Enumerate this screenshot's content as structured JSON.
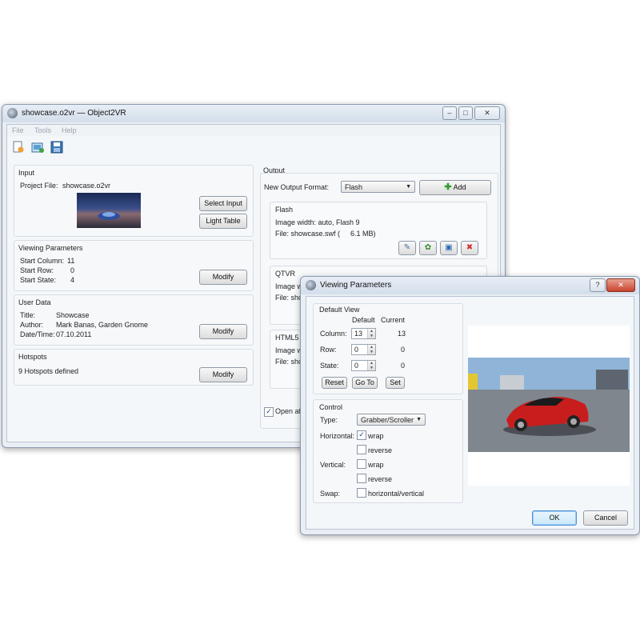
{
  "main": {
    "title": "showcase.o2vr — Object2VR",
    "menu": [
      "File",
      "Tools",
      "Help"
    ],
    "toolbar_icons": [
      "new-project-icon",
      "open-project-icon",
      "save-project-icon"
    ],
    "input": {
      "title": "Input",
      "project_file_label": "Project File:",
      "project_file": "showcase.o2vr",
      "select_input": "Select Input",
      "light_table": "Light Table"
    },
    "viewing": {
      "title": "Viewing Parameters",
      "start_column_label": "Start Column:",
      "start_column": "11",
      "start_row_label": "Start Row:",
      "start_row": "0",
      "start_state_label": "Start State:",
      "start_state": "4",
      "modify": "Modify"
    },
    "user_data": {
      "title": "User Data",
      "title_label": "Title:",
      "title_value": "Showcase",
      "author_label": "Author:",
      "author_value": "Mark Banas, Garden Gnome",
      "date_label": "Date/Time:",
      "date_value": "07.10.2011",
      "modify": "Modify"
    },
    "hotspots": {
      "title": "Hotspots",
      "text": "9 Hotspots defined",
      "modify": "Modify"
    },
    "output": {
      "title": "Output",
      "new_format_label": "New Output Format:",
      "format": "Flash",
      "add": "Add",
      "flash": {
        "title": "Flash",
        "line1": "Image width: auto, Flash 9",
        "line2": "File: showcase.swf (",
        "size": "6.1 MB)"
      },
      "qtvr": {
        "title": "QTVR",
        "line1": "Image w",
        "line2": "File: sho"
      },
      "html5": {
        "title": "HTML5",
        "line1": "Image wi",
        "line2": "File: sho"
      },
      "open_after": "Open aft"
    }
  },
  "dialog": {
    "title": "Viewing Parameters",
    "help": "?",
    "close": "✕",
    "default_view": {
      "title": "Default View",
      "col_default": "Default",
      "col_current": "Current",
      "rows": [
        {
          "label": "Column:",
          "default": "13",
          "current": "13"
        },
        {
          "label": "Row:",
          "default": "0",
          "current": "0"
        },
        {
          "label": "State:",
          "default": "0",
          "current": "0"
        }
      ],
      "reset": "Reset",
      "goto": "Go To",
      "set": "Set"
    },
    "control": {
      "title": "Control",
      "type_label": "Type:",
      "type_value": "Grabber/Scroller",
      "horizontal_label": "Horizontal:",
      "wrap": "wrap",
      "reverse": "reverse",
      "vertical_label": "Vertical:",
      "swap_label": "Swap:",
      "swap_value": "horizontal/vertical",
      "horizontal_wrap": true,
      "horizontal_reverse": false,
      "vertical_wrap": false,
      "vertical_reverse": false,
      "swap": false
    },
    "ok": "OK",
    "cancel": "Cancel"
  }
}
